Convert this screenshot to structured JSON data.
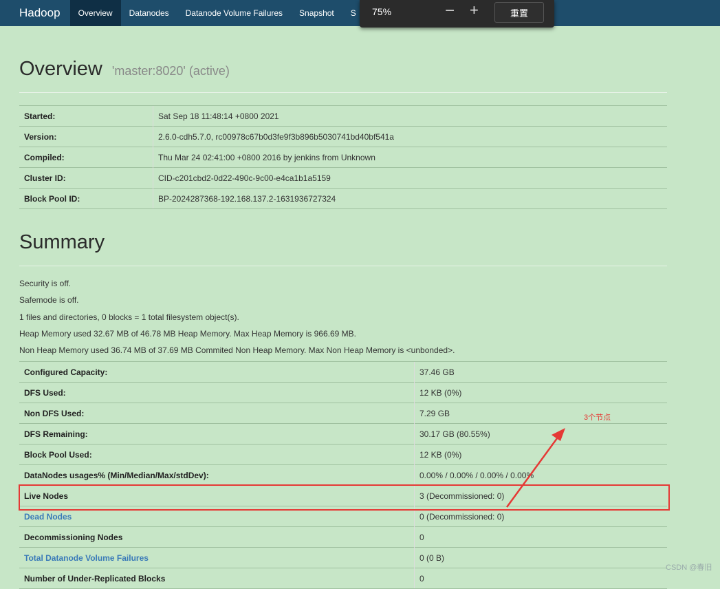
{
  "navbar": {
    "brand": "Hadoop",
    "items": [
      {
        "label": "Overview",
        "active": true
      },
      {
        "label": "Datanodes",
        "active": false
      },
      {
        "label": "Datanode Volume Failures",
        "active": false
      },
      {
        "label": "Snapshot",
        "active": false
      },
      {
        "label": "S",
        "active": false
      }
    ]
  },
  "zoom": {
    "percent": "75%",
    "minus": "−",
    "plus": "+",
    "reset": "重置"
  },
  "overview": {
    "title": "Overview",
    "subtitle": "'master:8020' (active)",
    "rows": [
      {
        "key": "Started:",
        "value": "Sat Sep 18 11:48:14 +0800 2021"
      },
      {
        "key": "Version:",
        "value": "2.6.0-cdh5.7.0, rc00978c67b0d3fe9f3b896b5030741bd40bf541a"
      },
      {
        "key": "Compiled:",
        "value": "Thu Mar 24 02:41:00 +0800 2016 by jenkins from Unknown"
      },
      {
        "key": "Cluster ID:",
        "value": "CID-c201cbd2-0d22-490c-9c00-e4ca1b1a5159"
      },
      {
        "key": "Block Pool ID:",
        "value": "BP-2024287368-192.168.137.2-1631936727324"
      }
    ]
  },
  "summary": {
    "title": "Summary",
    "lines": [
      "Security is off.",
      "Safemode is off.",
      "1 files and directories, 0 blocks = 1 total filesystem object(s).",
      "Heap Memory used 32.67 MB of 46.78 MB Heap Memory. Max Heap Memory is 966.69 MB.",
      "Non Heap Memory used 36.74 MB of 37.69 MB Commited Non Heap Memory. Max Non Heap Memory is <unbonded>."
    ],
    "rows": [
      {
        "key": "Configured Capacity:",
        "value": "37.46 GB",
        "link": false
      },
      {
        "key": "DFS Used:",
        "value": "12 KB (0%)",
        "link": false
      },
      {
        "key": "Non DFS Used:",
        "value": "7.29 GB",
        "link": false
      },
      {
        "key": "DFS Remaining:",
        "value": "30.17 GB (80.55%)",
        "link": false
      },
      {
        "key": "Block Pool Used:",
        "value": "12 KB (0%)",
        "link": false
      },
      {
        "key": "DataNodes usages% (Min/Median/Max/stdDev):",
        "value": "0.00% / 0.00% / 0.00% / 0.00%",
        "link": false
      },
      {
        "key": "Live Nodes",
        "value": "3 (Decommissioned: 0)",
        "link": false
      },
      {
        "key": "Dead Nodes",
        "value": "0 (Decommissioned: 0)",
        "link": true
      },
      {
        "key": "Decommissioning Nodes",
        "value": "0",
        "link": false
      },
      {
        "key": "Total Datanode Volume Failures",
        "value": "0 (0 B)",
        "link": true
      },
      {
        "key": "Number of Under-Replicated Blocks",
        "value": "0",
        "link": false
      }
    ]
  },
  "annotation": {
    "text": "3个节点",
    "color": "#e53935"
  },
  "watermark": "CSDN @春旧"
}
